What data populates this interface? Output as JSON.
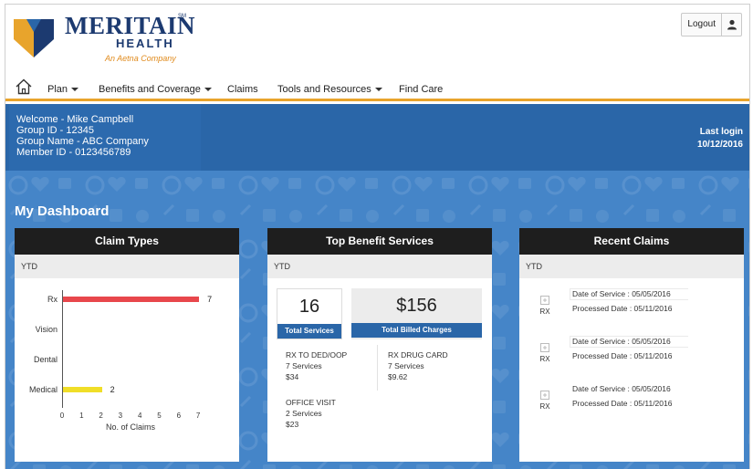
{
  "header": {
    "brand_name": "MERITAIN",
    "brand_sm": "SM",
    "brand_health": "HEALTH",
    "brand_tagline": "An Aetna Company",
    "logout_label": "Logout"
  },
  "nav": {
    "items": [
      {
        "label": "Plan",
        "dropdown": true
      },
      {
        "label": "Benefits and Coverage",
        "dropdown": true
      },
      {
        "label": "Claims",
        "dropdown": false
      },
      {
        "label": "Tools and Resources",
        "dropdown": true
      },
      {
        "label": "Find Care",
        "dropdown": false
      }
    ],
    "accent_color": "#e8a42c"
  },
  "welcome": {
    "line1": "Welcome - Mike Campbell",
    "line2": "Group ID - 12345",
    "line3": "Group Name - ABC Company",
    "line4": "Member ID - 0123456789",
    "last_login_label": "Last login",
    "last_login_date": "10/12/2016"
  },
  "dashboard": {
    "title": "My Dashboard",
    "claim_types": {
      "title": "Claim Types",
      "period": "YTD"
    },
    "top_benefits": {
      "title": "Top Benefit Services",
      "period": "YTD",
      "total_services": "16",
      "total_services_label": "Total Services",
      "total_charges": "$156",
      "total_charges_label": "Total Billed Charges",
      "services": [
        {
          "name": "RX TO DED/OOP",
          "count": "7 Services",
          "amount": "$34"
        },
        {
          "name": "RX DRUG CARD",
          "count": "7 Services",
          "amount": "$9.62"
        },
        {
          "name": "OFFICE VISIT",
          "count": "2 Services",
          "amount": "$23"
        }
      ]
    },
    "recent_claims": {
      "title": "Recent Claims",
      "period": "YTD",
      "items": [
        {
          "type": "RX",
          "dos": "Date of Service : 05/05/2016",
          "processed": "Processed Date : 05/11/2016"
        },
        {
          "type": "RX",
          "dos": "Date of Service : 05/05/2016",
          "processed": "Processed Date : 05/11/2016"
        },
        {
          "type": "RX",
          "dos": "Date of Service : 05/05/2016",
          "processed": "Processed Date : 05/11/2016"
        }
      ]
    }
  },
  "chart_data": {
    "type": "bar",
    "orientation": "horizontal",
    "categories": [
      "Rx",
      "Vision",
      "Dental",
      "Medical"
    ],
    "values": [
      7,
      0,
      0,
      2
    ],
    "colors": [
      "#e8474c",
      "#e8474c",
      "#e8474c",
      "#f0de28"
    ],
    "xlabel": "No. of Claims",
    "xlim": [
      0,
      7
    ],
    "xticks": [
      "0",
      "1",
      "2",
      "3",
      "4",
      "5",
      "6",
      "7"
    ],
    "grid": false
  },
  "colors": {
    "brand_navy": "#1c3a70",
    "brand_orange": "#e08a1c",
    "welcome_bg": "#2a66a8",
    "dashboard_bg": "#4585c8",
    "card_header": "#1e1e1e",
    "stat_label_bg": "#2a66a8"
  }
}
